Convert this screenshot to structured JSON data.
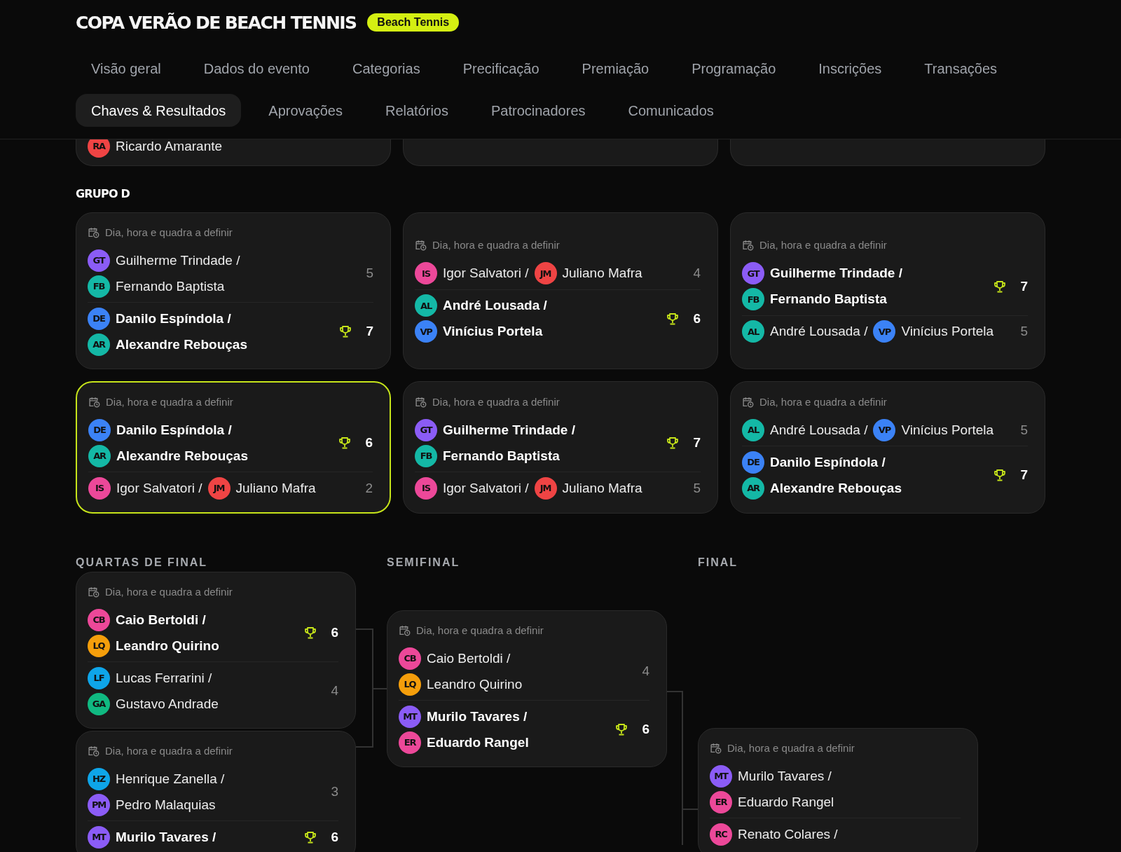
{
  "event": {
    "title": "COPA VERÃO DE BEACH TENNIS",
    "badge": "Beach Tennis"
  },
  "tab_rows": [
    {
      "tabs": [
        {
          "label": "Visão geral",
          "selected": false
        },
        {
          "label": "Dados do evento",
          "selected": false
        },
        {
          "label": "Categorias",
          "selected": false
        },
        {
          "label": "Precificação",
          "selected": false
        },
        {
          "label": "Premiação",
          "selected": false
        },
        {
          "label": "Programação",
          "selected": false
        },
        {
          "label": "Inscrições",
          "selected": false
        },
        {
          "label": "Transações",
          "selected": false
        }
      ]
    },
    {
      "tabs": [
        {
          "label": "Chaves & Resultados",
          "selected": true
        },
        {
          "label": "Aprovações",
          "selected": false
        },
        {
          "label": "Relatórios",
          "selected": false
        },
        {
          "label": "Patrocinadores",
          "selected": false
        },
        {
          "label": "Comunicados",
          "selected": false
        }
      ]
    }
  ],
  "previous_group_tail": {
    "players": [
      {
        "initials": "RA",
        "name": "Ricardo Amarante",
        "color": "#ef4444"
      }
    ]
  },
  "group": {
    "title": "GRUPO D",
    "matches": [
      {
        "schedule": "Dia, hora e quadra a definir",
        "highlighted": false,
        "teams": [
          {
            "kind": "stacked",
            "winner": false,
            "score": "5",
            "players": [
              {
                "initials": "GT",
                "name": "Guilherme Trindade /",
                "color": "#8b5cf6"
              },
              {
                "initials": "FB",
                "name": "Fernando Baptista",
                "color": "#14b8a6"
              }
            ]
          },
          {
            "kind": "stacked",
            "winner": true,
            "score": "7",
            "players": [
              {
                "initials": "DE",
                "name": "Danilo Espíndola /",
                "color": "#3b82f6"
              },
              {
                "initials": "AR",
                "name": "Alexandre Rebouças",
                "color": "#14b8a6"
              }
            ]
          }
        ]
      },
      {
        "schedule": "Dia, hora e quadra a definir",
        "highlighted": false,
        "teams": [
          {
            "kind": "inline",
            "winner": false,
            "score": "4",
            "players": [
              {
                "initials": "IS",
                "name": "Igor Salvatori /",
                "color": "#ec4899"
              },
              {
                "initials": "JM",
                "name": "Juliano Mafra",
                "color": "#ef4444"
              }
            ]
          },
          {
            "kind": "stacked",
            "winner": true,
            "score": "6",
            "players": [
              {
                "initials": "AL",
                "name": "André Lousada /",
                "color": "#14b8a6"
              },
              {
                "initials": "VP",
                "name": "Vinícius Portela",
                "color": "#3b82f6"
              }
            ]
          }
        ]
      },
      {
        "schedule": "Dia, hora e quadra a definir",
        "highlighted": false,
        "teams": [
          {
            "kind": "stacked",
            "winner": true,
            "score": "7",
            "players": [
              {
                "initials": "GT",
                "name": "Guilherme Trindade /",
                "color": "#8b5cf6"
              },
              {
                "initials": "FB",
                "name": "Fernando Baptista",
                "color": "#14b8a6"
              }
            ]
          },
          {
            "kind": "inline",
            "winner": false,
            "score": "5",
            "players": [
              {
                "initials": "AL",
                "name": "André Lousada /",
                "color": "#14b8a6"
              },
              {
                "initials": "VP",
                "name": "Vinícius Portela",
                "color": "#3b82f6"
              }
            ]
          }
        ]
      },
      {
        "schedule": "Dia, hora e quadra a definir",
        "highlighted": true,
        "teams": [
          {
            "kind": "stacked",
            "winner": true,
            "score": "6",
            "players": [
              {
                "initials": "DE",
                "name": "Danilo Espíndola /",
                "color": "#3b82f6"
              },
              {
                "initials": "AR",
                "name": "Alexandre Rebouças",
                "color": "#14b8a6"
              }
            ]
          },
          {
            "kind": "inline",
            "winner": false,
            "score": "2",
            "players": [
              {
                "initials": "IS",
                "name": "Igor Salvatori /",
                "color": "#ec4899"
              },
              {
                "initials": "JM",
                "name": "Juliano Mafra",
                "color": "#ef4444"
              }
            ]
          }
        ]
      },
      {
        "schedule": "Dia, hora e quadra a definir",
        "highlighted": false,
        "teams": [
          {
            "kind": "stacked",
            "winner": true,
            "score": "7",
            "players": [
              {
                "initials": "GT",
                "name": "Guilherme Trindade /",
                "color": "#8b5cf6"
              },
              {
                "initials": "FB",
                "name": "Fernando Baptista",
                "color": "#14b8a6"
              }
            ]
          },
          {
            "kind": "inline",
            "winner": false,
            "score": "5",
            "players": [
              {
                "initials": "IS",
                "name": "Igor Salvatori /",
                "color": "#ec4899"
              },
              {
                "initials": "JM",
                "name": "Juliano Mafra",
                "color": "#ef4444"
              }
            ]
          }
        ]
      },
      {
        "schedule": "Dia, hora e quadra a definir",
        "highlighted": false,
        "teams": [
          {
            "kind": "inline",
            "winner": false,
            "score": "5",
            "players": [
              {
                "initials": "AL",
                "name": "André Lousada /",
                "color": "#14b8a6"
              },
              {
                "initials": "VP",
                "name": "Vinícius Portela",
                "color": "#3b82f6"
              }
            ]
          },
          {
            "kind": "stacked",
            "winner": true,
            "score": "7",
            "players": [
              {
                "initials": "DE",
                "name": "Danilo Espíndola /",
                "color": "#3b82f6"
              },
              {
                "initials": "AR",
                "name": "Alexandre Rebouças",
                "color": "#14b8a6"
              }
            ]
          }
        ]
      }
    ]
  },
  "bracket": {
    "rounds": [
      {
        "title": "QUARTAS DE FINAL",
        "matches": [
          {
            "schedule": "Dia, hora e quadra a definir",
            "highlighted": false,
            "teams": [
              {
                "kind": "stacked",
                "winner": true,
                "score": "6",
                "players": [
                  {
                    "initials": "CB",
                    "name": "Caio Bertoldi /",
                    "color": "#ec4899"
                  },
                  {
                    "initials": "LQ",
                    "name": "Leandro Quirino",
                    "color": "#f59e0b"
                  }
                ]
              },
              {
                "kind": "stacked",
                "winner": false,
                "score": "4",
                "players": [
                  {
                    "initials": "LF",
                    "name": "Lucas Ferrarini /",
                    "color": "#0ea5e9"
                  },
                  {
                    "initials": "GA",
                    "name": "Gustavo Andrade",
                    "color": "#10b981"
                  }
                ]
              }
            ]
          },
          {
            "schedule": "Dia, hora e quadra a definir",
            "highlighted": false,
            "teams": [
              {
                "kind": "stacked",
                "winner": false,
                "score": "3",
                "players": [
                  {
                    "initials": "HZ",
                    "name": "Henrique Zanella /",
                    "color": "#0ea5e9"
                  },
                  {
                    "initials": "PM",
                    "name": "Pedro Malaquias",
                    "color": "#8b5cf6"
                  }
                ]
              },
              {
                "kind": "stacked",
                "winner": true,
                "score": "6",
                "players": [
                  {
                    "initials": "MT",
                    "name": "Murilo Tavares /",
                    "color": "#8b5cf6"
                  }
                ]
              }
            ]
          }
        ]
      },
      {
        "title": "SEMIFINAL",
        "matches": [
          {
            "schedule": "Dia, hora e quadra a definir",
            "highlighted": false,
            "teams": [
              {
                "kind": "stacked",
                "winner": false,
                "score": "4",
                "players": [
                  {
                    "initials": "CB",
                    "name": "Caio Bertoldi /",
                    "color": "#ec4899"
                  },
                  {
                    "initials": "LQ",
                    "name": "Leandro Quirino",
                    "color": "#f59e0b"
                  }
                ]
              },
              {
                "kind": "stacked",
                "winner": true,
                "score": "6",
                "players": [
                  {
                    "initials": "MT",
                    "name": "Murilo Tavares /",
                    "color": "#8b5cf6"
                  },
                  {
                    "initials": "ER",
                    "name": "Eduardo Rangel",
                    "color": "#ec4899"
                  }
                ]
              }
            ]
          }
        ]
      },
      {
        "title": "FINAL",
        "matches": [
          {
            "schedule": "Dia, hora e quadra a definir",
            "highlighted": false,
            "teams": [
              {
                "kind": "stacked",
                "winner": false,
                "players": [
                  {
                    "initials": "MT",
                    "name": "Murilo Tavares /",
                    "color": "#8b5cf6"
                  },
                  {
                    "initials": "ER",
                    "name": "Eduardo Rangel",
                    "color": "#ec4899"
                  }
                ]
              },
              {
                "kind": "stacked",
                "winner": false,
                "players": [
                  {
                    "initials": "RC",
                    "name": "Renato Colares /",
                    "color": "#ec4899"
                  }
                ]
              }
            ]
          }
        ]
      }
    ]
  }
}
